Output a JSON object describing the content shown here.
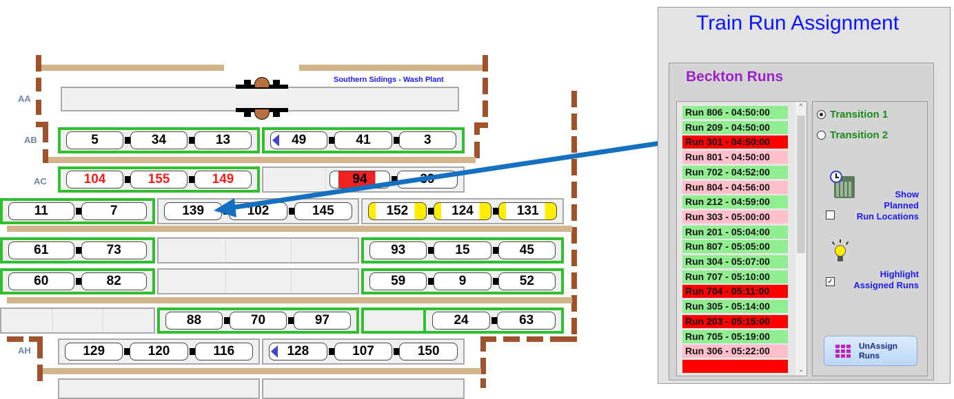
{
  "yard": {
    "title": "Southern Sidings - Wash Plant",
    "track_labels": {
      "AA": "AA",
      "AB": "AB",
      "AC": "AC",
      "AH": "AH"
    },
    "rows": {
      "ab_left": [
        "5",
        "34",
        "13"
      ],
      "ab_right": [
        "49",
        "41",
        "3"
      ],
      "ac_left": [
        "104",
        "155",
        "149"
      ],
      "ac_right": [
        "94",
        "39"
      ],
      "r4_left": [
        "11",
        "7"
      ],
      "r4_mid": [
        "139",
        "102",
        "145"
      ],
      "r4_right": [
        "152",
        "124",
        "131"
      ],
      "r5_left": [
        "61",
        "73"
      ],
      "r5_right": [
        "93",
        "15",
        "45"
      ],
      "r6_left": [
        "60",
        "82"
      ],
      "r6_right": [
        "59",
        "9",
        "52"
      ],
      "r7_mid": [
        "88",
        "70",
        "97"
      ],
      "r7_right": [
        "24",
        "63"
      ],
      "ah_left": [
        "129",
        "120",
        "116"
      ],
      "ah_right": [
        "128",
        "107",
        "150"
      ]
    }
  },
  "panel": {
    "title": "Train Run Assignment",
    "group_title": "Beckton Runs",
    "runs": [
      {
        "label": "Run 806 - 04:50:00",
        "status": "green"
      },
      {
        "label": "Run 209 - 04:50:00",
        "status": "green"
      },
      {
        "label": "Run 301 - 04:50:00",
        "status": "red"
      },
      {
        "label": "Run 801 - 04:50:00",
        "status": "pink"
      },
      {
        "label": "Run 702 - 04:52:00",
        "status": "green"
      },
      {
        "label": "Run 804 - 04:56:00",
        "status": "pink"
      },
      {
        "label": "Run 212 - 04:59:00",
        "status": "green"
      },
      {
        "label": "Run 303 - 05:00:00",
        "status": "pink"
      },
      {
        "label": "Run 201 - 05:04:00",
        "status": "green"
      },
      {
        "label": "Run 807 - 05:05:00",
        "status": "green"
      },
      {
        "label": "Run 304 - 05:07:00",
        "status": "green"
      },
      {
        "label": "Run 707 - 05:10:00",
        "status": "green"
      },
      {
        "label": "Run 704 - 05:11:00",
        "status": "red"
      },
      {
        "label": "Run 305 - 05:14:00",
        "status": "green"
      },
      {
        "label": "Run 203 - 05:15:00",
        "status": "red"
      },
      {
        "label": "Run 705 - 05:19:00",
        "status": "green"
      },
      {
        "label": "Run 306 - 05:22:00",
        "status": "pink"
      }
    ],
    "status_colors": {
      "green": "#90ee90",
      "red": "#ff0000",
      "pink": "#ffc0cb"
    },
    "transition1": "Transition 1",
    "transition2": "Transition 2",
    "show_planned": "Show Planned Run Locations",
    "show_planned_lines": [
      "Show",
      "Planned",
      "Run Locations"
    ],
    "highlight_lines": [
      "Highlight",
      "Assigned Runs"
    ],
    "unassign_label": "UnAssign Runs",
    "checkmark": "✓"
  }
}
